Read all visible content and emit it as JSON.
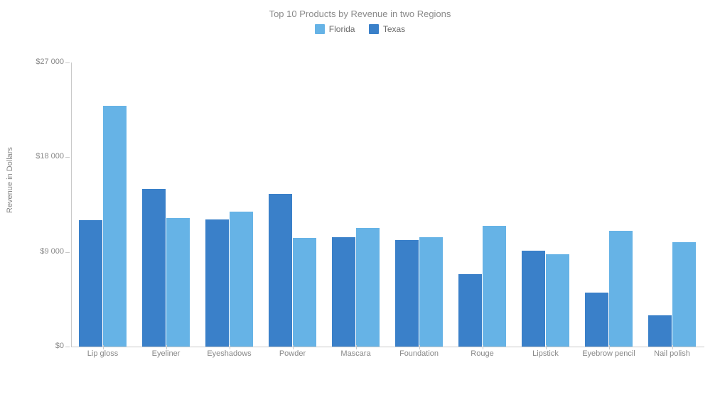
{
  "chart_data": {
    "type": "bar",
    "title": "Top 10 Products by Revenue in two Regions",
    "ylabel": "Revenue in Dollars",
    "xlabel": "",
    "ylim": [
      0,
      27000
    ],
    "yticks": [
      0,
      9000,
      18000,
      27000
    ],
    "ytick_labels": [
      "$0",
      "$9 000",
      "$18 000",
      "$27 000"
    ],
    "categories": [
      "Lip gloss",
      "Eyeliner",
      "Eyeshadows",
      "Powder",
      "Mascara",
      "Foundation",
      "Rouge",
      "Lipstick",
      "Eyebrow pencil",
      "Nail polish"
    ],
    "series": [
      {
        "name": "Florida",
        "color": "#66b3e6",
        "values": [
          22900,
          12200,
          12800,
          10300,
          11300,
          10400,
          11500,
          8800,
          11000,
          9900
        ]
      },
      {
        "name": "Texas",
        "color": "#3a80c9",
        "values": [
          12000,
          15000,
          12100,
          14500,
          10400,
          10100,
          6900,
          9100,
          5100,
          3000
        ]
      }
    ],
    "legend_position": "top"
  }
}
